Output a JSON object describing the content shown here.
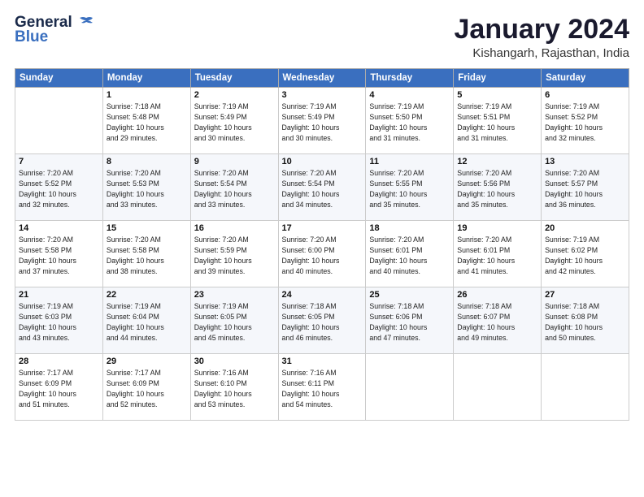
{
  "header": {
    "logo_line1": "General",
    "logo_line2": "Blue",
    "month_title": "January 2024",
    "location": "Kishangarh, Rajasthan, India"
  },
  "days_of_week": [
    "Sunday",
    "Monday",
    "Tuesday",
    "Wednesday",
    "Thursday",
    "Friday",
    "Saturday"
  ],
  "weeks": [
    [
      {
        "day": "",
        "info": ""
      },
      {
        "day": "1",
        "info": "Sunrise: 7:18 AM\nSunset: 5:48 PM\nDaylight: 10 hours\nand 29 minutes."
      },
      {
        "day": "2",
        "info": "Sunrise: 7:19 AM\nSunset: 5:49 PM\nDaylight: 10 hours\nand 30 minutes."
      },
      {
        "day": "3",
        "info": "Sunrise: 7:19 AM\nSunset: 5:49 PM\nDaylight: 10 hours\nand 30 minutes."
      },
      {
        "day": "4",
        "info": "Sunrise: 7:19 AM\nSunset: 5:50 PM\nDaylight: 10 hours\nand 31 minutes."
      },
      {
        "day": "5",
        "info": "Sunrise: 7:19 AM\nSunset: 5:51 PM\nDaylight: 10 hours\nand 31 minutes."
      },
      {
        "day": "6",
        "info": "Sunrise: 7:19 AM\nSunset: 5:52 PM\nDaylight: 10 hours\nand 32 minutes."
      }
    ],
    [
      {
        "day": "7",
        "info": "Sunrise: 7:20 AM\nSunset: 5:52 PM\nDaylight: 10 hours\nand 32 minutes."
      },
      {
        "day": "8",
        "info": "Sunrise: 7:20 AM\nSunset: 5:53 PM\nDaylight: 10 hours\nand 33 minutes."
      },
      {
        "day": "9",
        "info": "Sunrise: 7:20 AM\nSunset: 5:54 PM\nDaylight: 10 hours\nand 33 minutes."
      },
      {
        "day": "10",
        "info": "Sunrise: 7:20 AM\nSunset: 5:54 PM\nDaylight: 10 hours\nand 34 minutes."
      },
      {
        "day": "11",
        "info": "Sunrise: 7:20 AM\nSunset: 5:55 PM\nDaylight: 10 hours\nand 35 minutes."
      },
      {
        "day": "12",
        "info": "Sunrise: 7:20 AM\nSunset: 5:56 PM\nDaylight: 10 hours\nand 35 minutes."
      },
      {
        "day": "13",
        "info": "Sunrise: 7:20 AM\nSunset: 5:57 PM\nDaylight: 10 hours\nand 36 minutes."
      }
    ],
    [
      {
        "day": "14",
        "info": "Sunrise: 7:20 AM\nSunset: 5:58 PM\nDaylight: 10 hours\nand 37 minutes."
      },
      {
        "day": "15",
        "info": "Sunrise: 7:20 AM\nSunset: 5:58 PM\nDaylight: 10 hours\nand 38 minutes."
      },
      {
        "day": "16",
        "info": "Sunrise: 7:20 AM\nSunset: 5:59 PM\nDaylight: 10 hours\nand 39 minutes."
      },
      {
        "day": "17",
        "info": "Sunrise: 7:20 AM\nSunset: 6:00 PM\nDaylight: 10 hours\nand 40 minutes."
      },
      {
        "day": "18",
        "info": "Sunrise: 7:20 AM\nSunset: 6:01 PM\nDaylight: 10 hours\nand 40 minutes."
      },
      {
        "day": "19",
        "info": "Sunrise: 7:20 AM\nSunset: 6:01 PM\nDaylight: 10 hours\nand 41 minutes."
      },
      {
        "day": "20",
        "info": "Sunrise: 7:19 AM\nSunset: 6:02 PM\nDaylight: 10 hours\nand 42 minutes."
      }
    ],
    [
      {
        "day": "21",
        "info": "Sunrise: 7:19 AM\nSunset: 6:03 PM\nDaylight: 10 hours\nand 43 minutes."
      },
      {
        "day": "22",
        "info": "Sunrise: 7:19 AM\nSunset: 6:04 PM\nDaylight: 10 hours\nand 44 minutes."
      },
      {
        "day": "23",
        "info": "Sunrise: 7:19 AM\nSunset: 6:05 PM\nDaylight: 10 hours\nand 45 minutes."
      },
      {
        "day": "24",
        "info": "Sunrise: 7:18 AM\nSunset: 6:05 PM\nDaylight: 10 hours\nand 46 minutes."
      },
      {
        "day": "25",
        "info": "Sunrise: 7:18 AM\nSunset: 6:06 PM\nDaylight: 10 hours\nand 47 minutes."
      },
      {
        "day": "26",
        "info": "Sunrise: 7:18 AM\nSunset: 6:07 PM\nDaylight: 10 hours\nand 49 minutes."
      },
      {
        "day": "27",
        "info": "Sunrise: 7:18 AM\nSunset: 6:08 PM\nDaylight: 10 hours\nand 50 minutes."
      }
    ],
    [
      {
        "day": "28",
        "info": "Sunrise: 7:17 AM\nSunset: 6:09 PM\nDaylight: 10 hours\nand 51 minutes."
      },
      {
        "day": "29",
        "info": "Sunrise: 7:17 AM\nSunset: 6:09 PM\nDaylight: 10 hours\nand 52 minutes."
      },
      {
        "day": "30",
        "info": "Sunrise: 7:16 AM\nSunset: 6:10 PM\nDaylight: 10 hours\nand 53 minutes."
      },
      {
        "day": "31",
        "info": "Sunrise: 7:16 AM\nSunset: 6:11 PM\nDaylight: 10 hours\nand 54 minutes."
      },
      {
        "day": "",
        "info": ""
      },
      {
        "day": "",
        "info": ""
      },
      {
        "day": "",
        "info": ""
      }
    ]
  ]
}
